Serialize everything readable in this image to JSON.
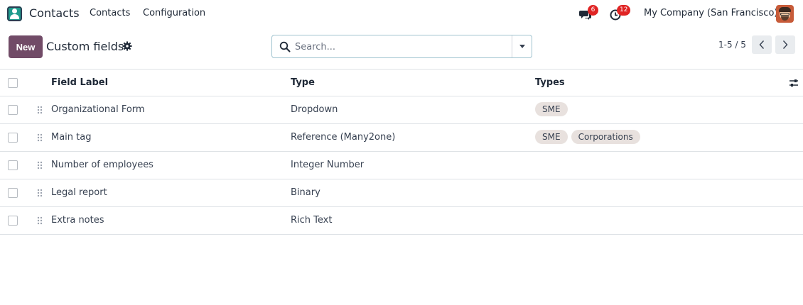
{
  "navbar": {
    "app_name": "Contacts",
    "menus": [
      "Contacts",
      "Configuration"
    ],
    "chat_count": "6",
    "activity_count": "12",
    "company": "My Company (San Francisco)"
  },
  "control_panel": {
    "new_label": "New",
    "title": "Custom fields",
    "search_placeholder": "Search...",
    "pager": "1-5 / 5"
  },
  "table": {
    "columns": [
      "Field Label",
      "Type",
      "Types"
    ],
    "rows": [
      {
        "label": "Organizational Form",
        "type": "Dropdown",
        "tags": [
          "SME"
        ]
      },
      {
        "label": "Main tag",
        "type": "Reference (Many2one)",
        "tags": [
          "SME",
          "Corporations"
        ]
      },
      {
        "label": "Number of employees",
        "type": "Integer Number",
        "tags": []
      },
      {
        "label": "Legal report",
        "type": "Binary",
        "tags": []
      },
      {
        "label": "Extra notes",
        "type": "Rich Text",
        "tags": []
      }
    ]
  },
  "colors": {
    "primary": "#714b67",
    "badge": "#e02424",
    "tag_bg": "#e8e1de",
    "app_icon": "#1f9c8e"
  },
  "icons": [
    "contacts-app-icon",
    "chat-icon",
    "clock-icon",
    "gear-icon",
    "search-icon",
    "caret-down-icon",
    "chevron-left-icon",
    "chevron-right-icon",
    "drag-handle-icon",
    "sliders-icon"
  ]
}
